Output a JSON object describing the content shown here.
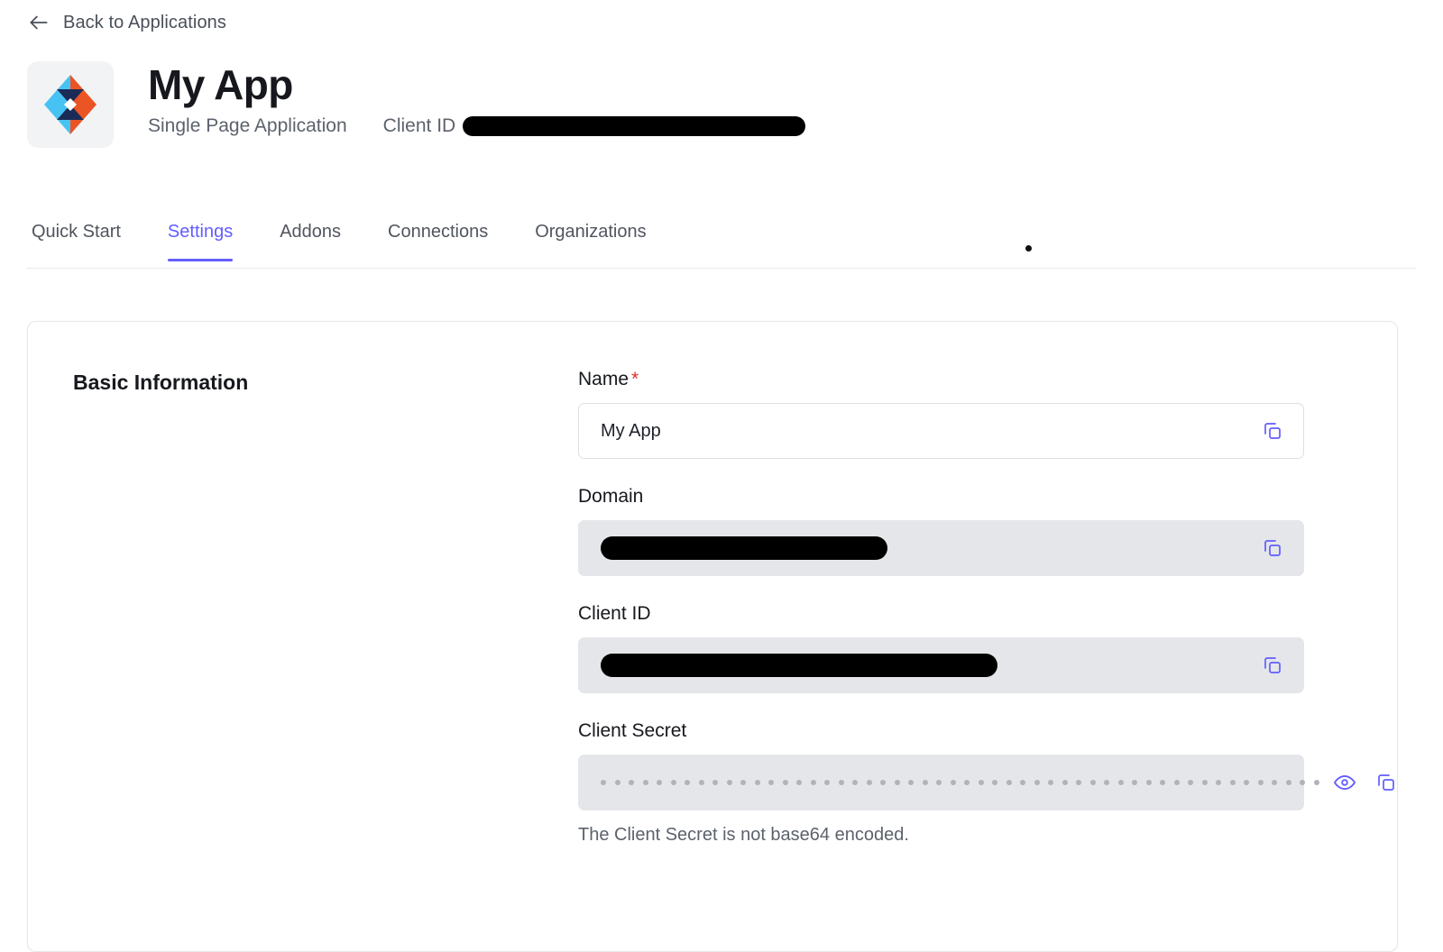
{
  "nav": {
    "back_label": "Back to Applications",
    "back_icon": "arrow-left-icon"
  },
  "app": {
    "title": "My App",
    "type": "Single Page Application",
    "client_id_label": "Client ID",
    "client_id_value": "",
    "client_id_redacted": true,
    "logo_icon": "auth0-diamond-logo",
    "logo_colors": {
      "blue": "#47c3f3",
      "navy": "#1a2c56",
      "orange": "#eb5424"
    }
  },
  "tabs": [
    {
      "label": "Quick Start",
      "active": false
    },
    {
      "label": "Settings",
      "active": true
    },
    {
      "label": "Addons",
      "active": false
    },
    {
      "label": "Connections",
      "active": false
    },
    {
      "label": "Organizations",
      "active": false
    }
  ],
  "accent_color": "#635dff",
  "settings": {
    "section_title": "Basic Information",
    "fields": {
      "name": {
        "label": "Name",
        "required": true,
        "value": "My App",
        "placeholder": "",
        "readonly": false,
        "copy_icon": "copy-icon"
      },
      "domain": {
        "label": "Domain",
        "required": false,
        "value": "",
        "redacted": true,
        "readonly": true,
        "copy_icon": "copy-icon"
      },
      "client_id": {
        "label": "Client ID",
        "required": false,
        "value": "",
        "redacted": true,
        "readonly": true,
        "copy_icon": "copy-icon"
      },
      "client_secret": {
        "label": "Client Secret",
        "required": false,
        "masked": true,
        "mask_dot_count": 52,
        "readonly": true,
        "reveal_icon": "eye-icon",
        "copy_icon": "copy-icon",
        "helper_text": "The Client Secret is not base64 encoded."
      }
    }
  }
}
